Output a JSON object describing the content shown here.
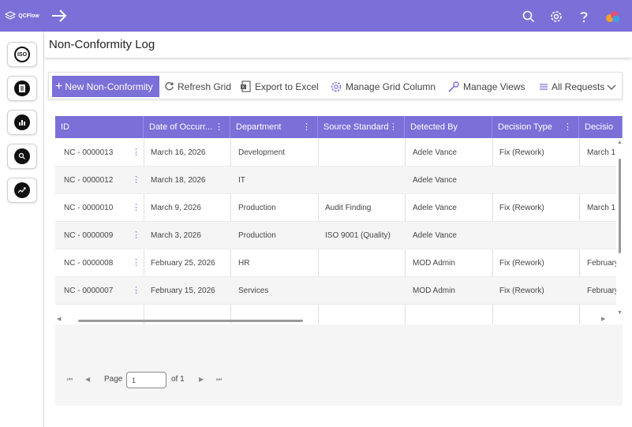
{
  "app": {
    "logo_text": "QCFlow"
  },
  "rail": {
    "items": [
      "iso",
      "document",
      "bar-chart",
      "search",
      "trend"
    ]
  },
  "page": {
    "title": "Non-Conformity Log"
  },
  "toolbar": {
    "new_label": "New Non-Conformity",
    "refresh_label": "Refresh Grid",
    "export_label": "Export to Excel",
    "manage_columns_label": "Manage Grid Column",
    "manage_views_label": "Manage Views",
    "view_select_label": "All Requests"
  },
  "grid": {
    "columns": [
      "ID",
      "Date of Occurr...",
      "Department",
      "Source Standard",
      "Detected By",
      "Decision Type",
      "Decisio"
    ],
    "rows": [
      [
        "NC - 0000013",
        "March 16, 2026",
        "Development",
        "",
        "Adele Vance",
        "Fix (Rework)",
        "March 1"
      ],
      [
        "NC - 0000012",
        "March 18, 2026",
        "IT",
        "",
        "Adele Vance",
        "",
        ""
      ],
      [
        "NC - 0000010",
        "March 9, 2026",
        "Production",
        "Audit Finding",
        "Adele Vance",
        "Fix (Rework)",
        "March 1"
      ],
      [
        "NC - 0000009",
        "March 3, 2026",
        "Production",
        "ISO 9001 (Quality)",
        "Adele Vance",
        "",
        ""
      ],
      [
        "NC - 0000008",
        "February 25, 2026",
        "HR",
        "",
        "MOD Admin",
        "Fix (Rework)",
        "February"
      ],
      [
        "NC - 0000007",
        "February 15, 2026",
        "Services",
        "",
        "MOD Admin",
        "Fix (Rework)",
        "February"
      ]
    ]
  },
  "pager": {
    "page_label": "Page",
    "page_value": "1",
    "of_label": "of 1"
  },
  "colors": {
    "accent": "#7b6fd8"
  }
}
